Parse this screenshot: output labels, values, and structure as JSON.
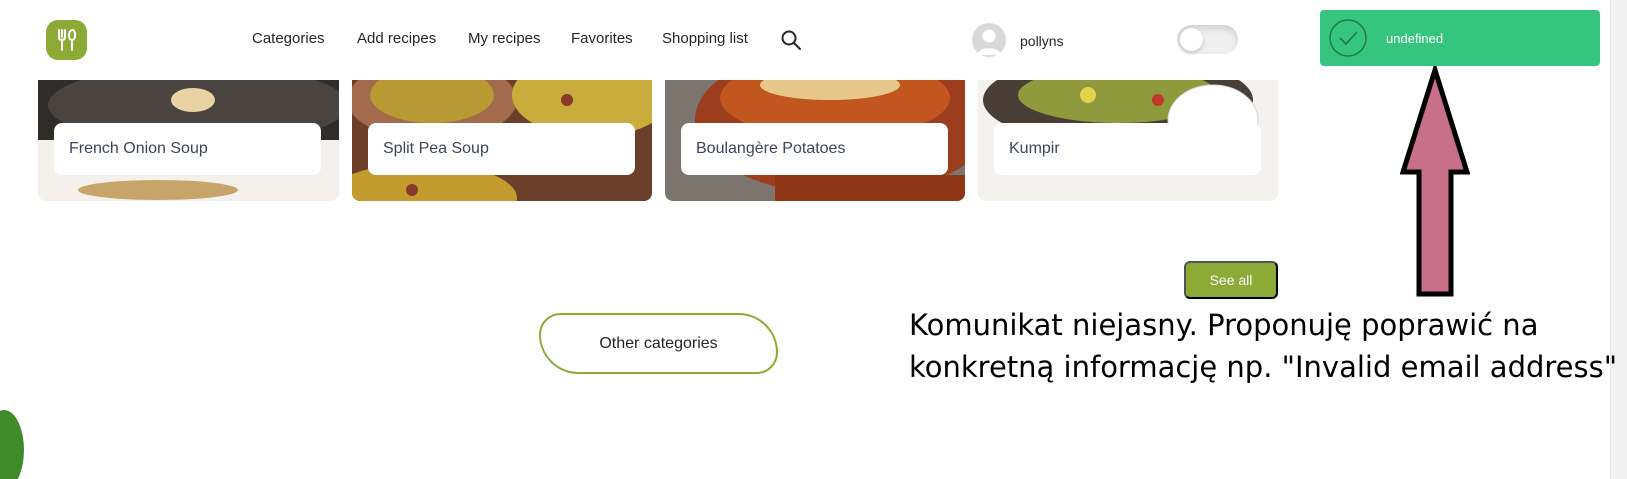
{
  "header": {
    "nav": [
      {
        "id": "categories",
        "label": "Categories"
      },
      {
        "id": "add-recipes",
        "label": "Add recipes"
      },
      {
        "id": "my-recipes",
        "label": "My recipes"
      },
      {
        "id": "favorites",
        "label": "Favorites"
      },
      {
        "id": "shopping-list",
        "label": "Shopping list"
      }
    ],
    "username": "pollyns",
    "theme_toggle_on": false
  },
  "toast": {
    "message": "undefined",
    "icon": "check-circle-icon",
    "color": "#35c57f"
  },
  "recipes": [
    {
      "title": "French Onion Soup"
    },
    {
      "title": "Split Pea Soup"
    },
    {
      "title": "Boulangère Potatoes"
    },
    {
      "title": "Kumpir"
    }
  ],
  "actions": {
    "see_all": "See all",
    "other_categories": "Other categories"
  },
  "annotation": {
    "line1": "Komunikat niejasny. Proponuję poprawić na",
    "line2": "konkretną informację np. \"Invalid email address\"",
    "arrow_color": "#c8708a"
  },
  "colors": {
    "accent": "#8baa36",
    "text_dark": "#23262a",
    "card_title": "#3e4462"
  }
}
